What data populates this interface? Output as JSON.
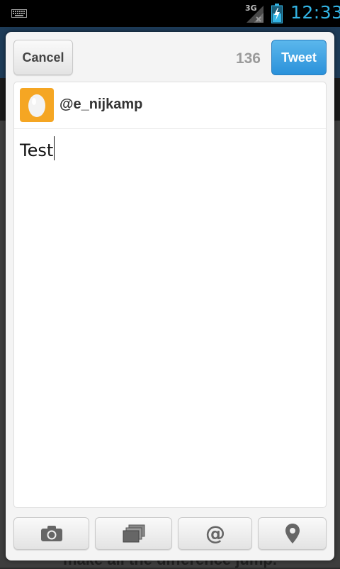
{
  "status_bar": {
    "time": "12:33",
    "network": "3G",
    "icons": [
      "keyboard-icon",
      "signal-icon",
      "battery-charging-icon"
    ]
  },
  "background": {
    "partial_text": "make all the difference jump."
  },
  "compose": {
    "cancel_label": "Cancel",
    "tweet_label": "Tweet",
    "char_count": "136",
    "username": "@e_nijkamp",
    "tweet_text": "Test"
  },
  "toolbar": {
    "buttons": [
      "camera-icon",
      "gallery-icon",
      "mention-icon",
      "location-icon"
    ]
  },
  "colors": {
    "accent": "#33b5e5",
    "tweet_button": "#2a91da",
    "avatar_bg": "#f5a623"
  }
}
